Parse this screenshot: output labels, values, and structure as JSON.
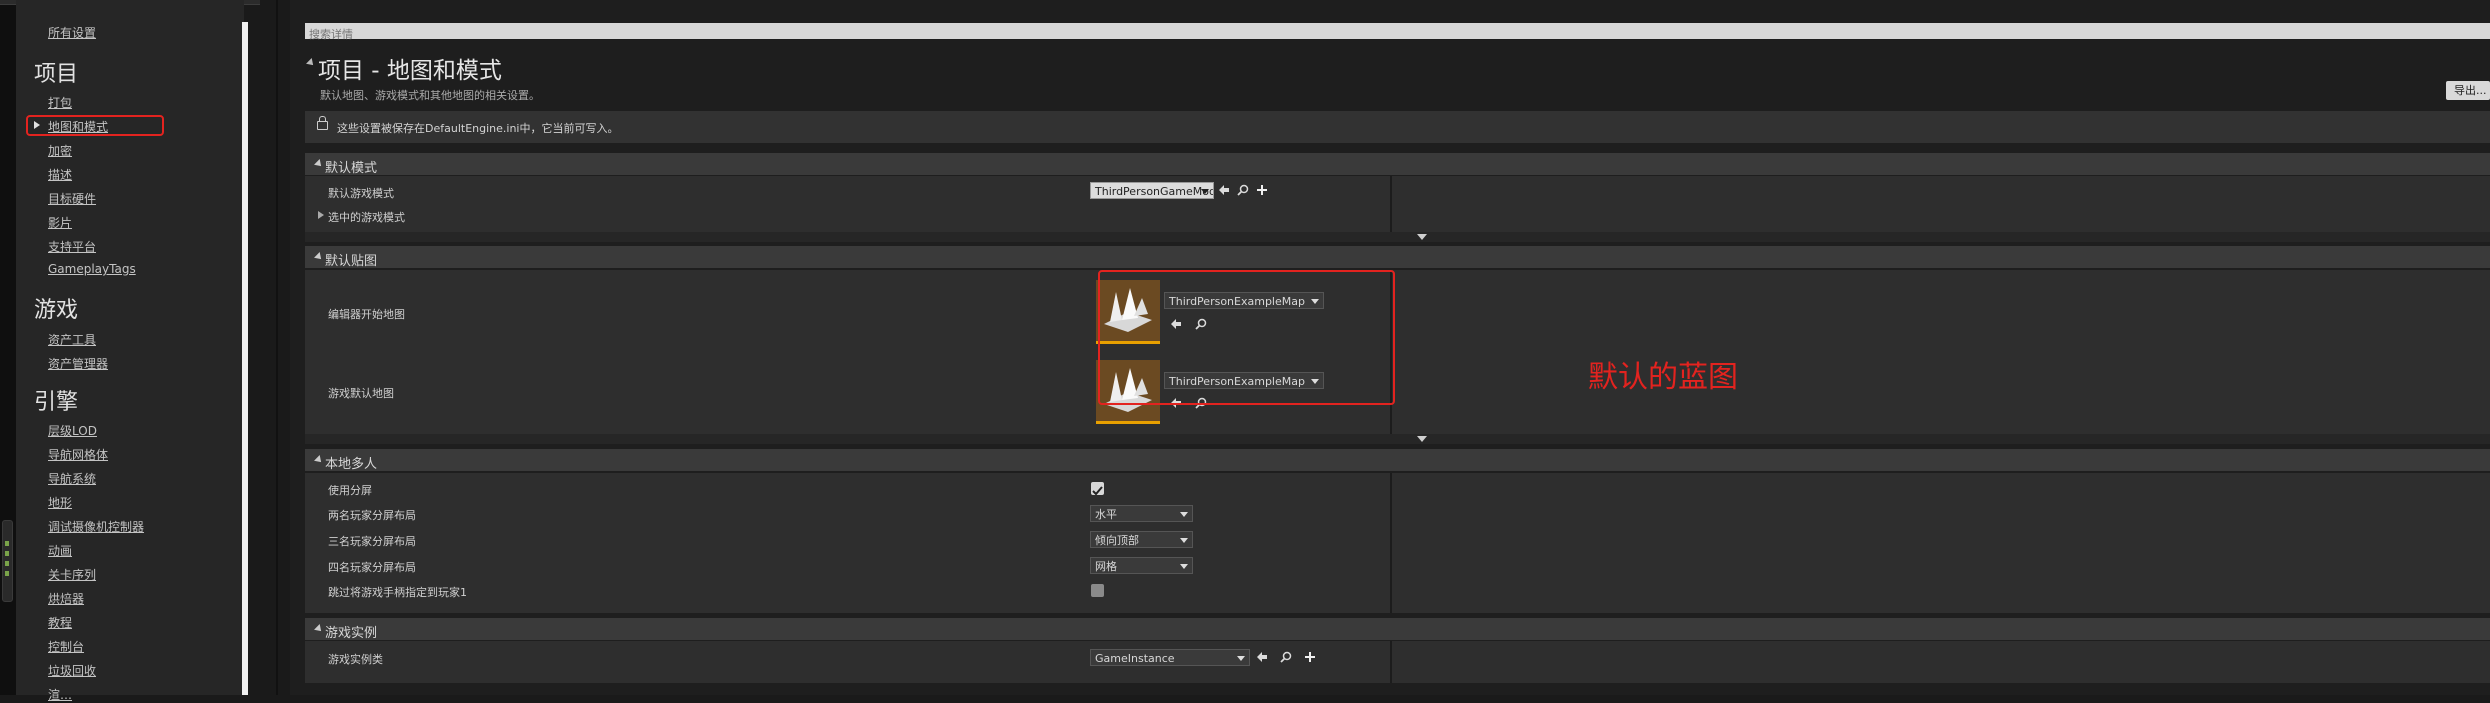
{
  "sidebar": {
    "all_settings": "所有设置",
    "section_project": "项目",
    "project_items": [
      "打包",
      "地图和模式",
      "加密",
      "描述",
      "目标硬件",
      "影片",
      "支持平台",
      "GameplayTags"
    ],
    "section_game": "游戏",
    "game_items": [
      "资产工具",
      "资产管理器"
    ],
    "section_engine": "引擎",
    "engine_items": [
      "层级LOD",
      "导航网格体",
      "导航系统",
      "地形",
      "调试摄像机控制器",
      "动画",
      "关卡序列",
      "烘焙器",
      "教程",
      "控制台",
      "垃圾回收",
      "渲…"
    ]
  },
  "search": {
    "placeholder": "搜索详情"
  },
  "header": {
    "title": "项目 - 地图和模式",
    "description": "默认地图、游戏模式和其他地图的相关设置。",
    "export_label": "导出..."
  },
  "notice": "这些设置被保存在DefaultEngine.ini中，它当前可写入。",
  "sections": {
    "default_modes": {
      "title": "默认模式",
      "default_game_mode_label": "默认游戏模式",
      "default_game_mode_value": "ThirdPersonGameMode",
      "selected_game_mode_label": "选中的游戏模式"
    },
    "default_maps": {
      "title": "默认贴图",
      "editor_startup_map_label": "编辑器开始地图",
      "editor_startup_map_value": "ThirdPersonExampleMap",
      "game_default_map_label": "游戏默认地图",
      "game_default_map_value": "ThirdPersonExampleMap"
    },
    "local_multiplayer": {
      "title": "本地多人",
      "use_splitscreen_label": "使用分屏",
      "use_splitscreen": true,
      "two_player_label": "两名玩家分屏布局",
      "two_player_value": "水平",
      "three_player_label": "三名玩家分屏布局",
      "three_player_value": "倾向顶部",
      "four_player_label": "四名玩家分屏布局",
      "four_player_value": "网格",
      "skip_assign_label": "跳过将游戏手柄指定到玩家1",
      "skip_assign": false
    },
    "game_instance": {
      "title": "游戏实例",
      "game_instance_class_label": "游戏实例类",
      "game_instance_class_value": "GameInstance"
    }
  },
  "annotation": "默认的蓝图",
  "colors": {
    "annotation_red": "#e3231f",
    "thumb_border": "#e8a000"
  },
  "icons": [
    "lock-icon",
    "arrow-left-icon",
    "search-icon",
    "plus-icon",
    "checkmark-icon",
    "map-thumbnail-icon"
  ]
}
